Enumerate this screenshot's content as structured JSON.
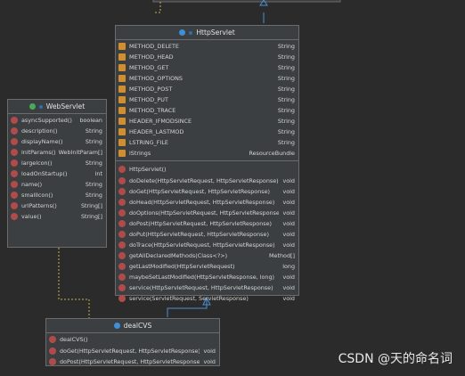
{
  "watermark": "CSDN @天的命名词",
  "colors": {
    "background": "#2b2b2b",
    "box": "#3c3f41",
    "border": "#6b6b6b",
    "arrow": "#4a8fd6",
    "dependency": "#c9b24a"
  },
  "http_servlet": {
    "title": "HttpServlet",
    "fields": [
      {
        "name": "METHOD_DELETE",
        "type": "String",
        "icon": "field-icon"
      },
      {
        "name": "METHOD_HEAD",
        "type": "String",
        "icon": "field-icon"
      },
      {
        "name": "METHOD_GET",
        "type": "String",
        "icon": "field-icon"
      },
      {
        "name": "METHOD_OPTIONS",
        "type": "String",
        "icon": "field-icon"
      },
      {
        "name": "METHOD_POST",
        "type": "String",
        "icon": "field-icon"
      },
      {
        "name": "METHOD_PUT",
        "type": "String",
        "icon": "field-icon"
      },
      {
        "name": "METHOD_TRACE",
        "type": "String",
        "icon": "field-icon"
      },
      {
        "name": "HEADER_IFMODSINCE",
        "type": "String",
        "icon": "field-icon"
      },
      {
        "name": "HEADER_LASTMOD",
        "type": "String",
        "icon": "field-icon"
      },
      {
        "name": "LSTRING_FILE",
        "type": "String",
        "icon": "field-icon"
      },
      {
        "name": "lStrings",
        "type": "ResourceBundle",
        "icon": "field-icon"
      }
    ],
    "constructors": [
      {
        "name": "HttpServlet()",
        "type": "",
        "icon": "method-icon"
      }
    ],
    "methods": [
      {
        "name": "doDelete(HttpServletRequest, HttpServletResponse)",
        "type": "void",
        "icon": "method-icon"
      },
      {
        "name": "doGet(HttpServletRequest, HttpServletResponse)",
        "type": "void",
        "icon": "method-icon"
      },
      {
        "name": "doHead(HttpServletRequest, HttpServletResponse)",
        "type": "void",
        "icon": "method-icon"
      },
      {
        "name": "doOptions(HttpServletRequest, HttpServletResponse)",
        "type": "void",
        "icon": "method-icon"
      },
      {
        "name": "doPost(HttpServletRequest, HttpServletResponse)",
        "type": "void",
        "icon": "method-icon"
      },
      {
        "name": "doPut(HttpServletRequest, HttpServletResponse)",
        "type": "void",
        "icon": "method-icon"
      },
      {
        "name": "doTrace(HttpServletRequest, HttpServletResponse)",
        "type": "void",
        "icon": "method-icon"
      },
      {
        "name": "getAllDeclaredMethods(Class<?>)",
        "type": "Method[]",
        "icon": "method-icon"
      },
      {
        "name": "getLastModified(HttpServletRequest)",
        "type": "long",
        "icon": "method-icon"
      },
      {
        "name": "maybeSetLastModified(HttpServletResponse, long)",
        "type": "void",
        "icon": "method-icon"
      },
      {
        "name": "service(HttpServletRequest, HttpServletResponse)",
        "type": "void",
        "icon": "method-icon"
      },
      {
        "name": "service(ServletRequest, ServletResponse)",
        "type": "void",
        "icon": "method-icon"
      }
    ]
  },
  "web_servlet": {
    "title": "WebServlet",
    "members": [
      {
        "name": "asyncSupported()",
        "type": "boolean",
        "icon": "method-icon"
      },
      {
        "name": "description()",
        "type": "String",
        "icon": "method-icon"
      },
      {
        "name": "displayName()",
        "type": "String",
        "icon": "method-icon"
      },
      {
        "name": "initParams()",
        "type": "WebInitParam[]",
        "icon": "method-icon"
      },
      {
        "name": "largeIcon()",
        "type": "String",
        "icon": "method-icon"
      },
      {
        "name": "loadOnStartup()",
        "type": "int",
        "icon": "method-icon"
      },
      {
        "name": "name()",
        "type": "String",
        "icon": "method-icon"
      },
      {
        "name": "smallIcon()",
        "type": "String",
        "icon": "method-icon"
      },
      {
        "name": "urlPatterns()",
        "type": "String[]",
        "icon": "method-icon"
      },
      {
        "name": "value()",
        "type": "String[]",
        "icon": "method-icon"
      }
    ]
  },
  "deal_cvs": {
    "title": "dealCVS",
    "constructors": [
      {
        "name": "dealCVS()",
        "type": "",
        "icon": "method-icon"
      }
    ],
    "methods": [
      {
        "name": "doGet(HttpServletRequest, HttpServletResponse)",
        "type": "void",
        "icon": "method-icon"
      },
      {
        "name": "doPost(HttpServletRequest, HttpServletResponse)",
        "type": "void",
        "icon": "method-icon"
      }
    ]
  }
}
